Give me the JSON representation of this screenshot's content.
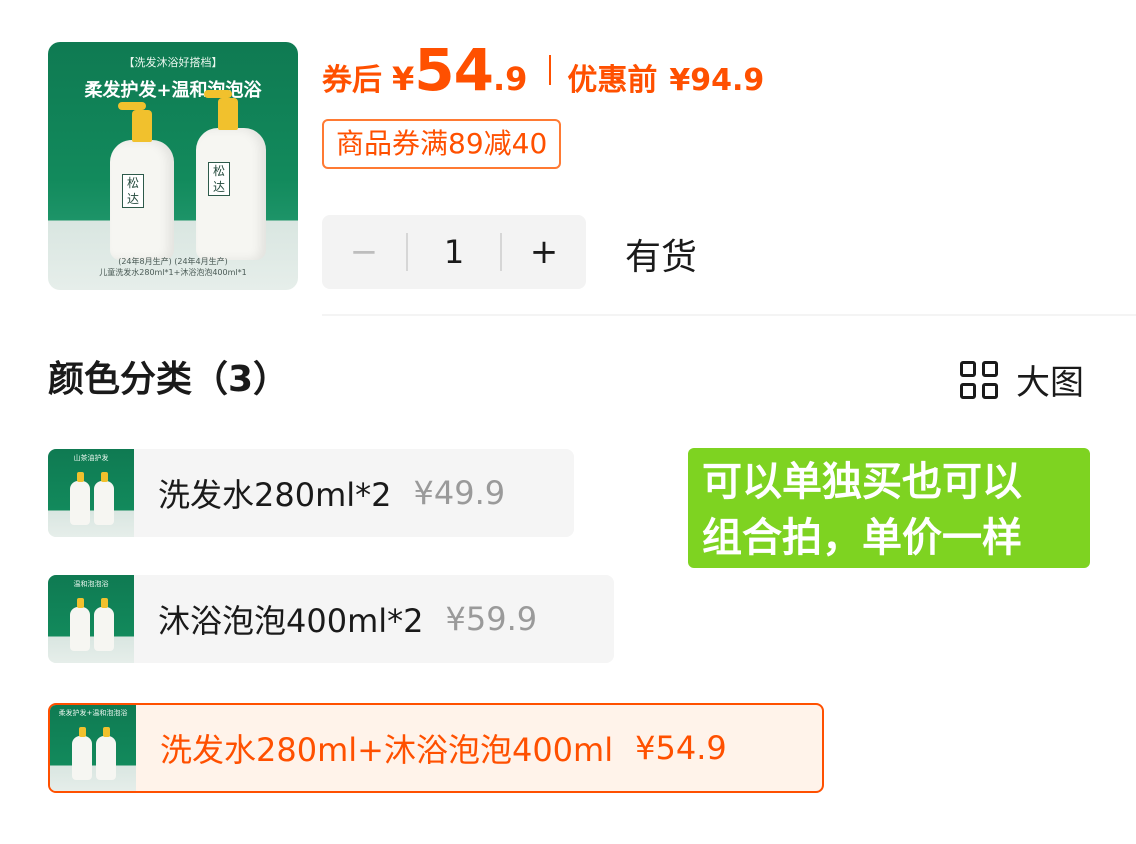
{
  "product": {
    "image_tagline": "【洗发沐浴好搭档】",
    "image_headline": "柔发护发+温和泡泡浴",
    "image_brand": "松达",
    "image_caption_line1": "(24年8月生产)        (24年4月生产)",
    "image_caption_line2": "儿童洗发水280ml*1+沐浴泡泡400ml*1"
  },
  "price": {
    "after_coupon_label": "券后",
    "currency": "¥",
    "integer": "54",
    "decimal": ".9",
    "original_label": "优惠前",
    "original_value": "¥94.9",
    "accent_color": "#ff5000"
  },
  "coupon": {
    "text": "商品券满89减40"
  },
  "quantity": {
    "minus": "−",
    "value": "1",
    "plus": "+",
    "stock_status": "有货"
  },
  "variants_section": {
    "title": "颜色分类（3）",
    "big_view_label": "大图",
    "big_view_icon": "grid-icon",
    "items": [
      {
        "thumb_label": "山茶油护发",
        "name": "洗发水280ml*2",
        "price": "¥49.9",
        "selected": false
      },
      {
        "thumb_label": "温和泡泡浴",
        "name": "沐浴泡泡400ml*2",
        "price": "¥59.9",
        "selected": false
      },
      {
        "thumb_label": "柔发护发+温和泡泡浴",
        "name": "洗发水280ml+沐浴泡泡400ml",
        "price": "¥54.9",
        "selected": true
      }
    ]
  },
  "note": {
    "line1": "可以单独买也可以",
    "line2": "组合拍，单价一样",
    "background": "#7ed321"
  }
}
